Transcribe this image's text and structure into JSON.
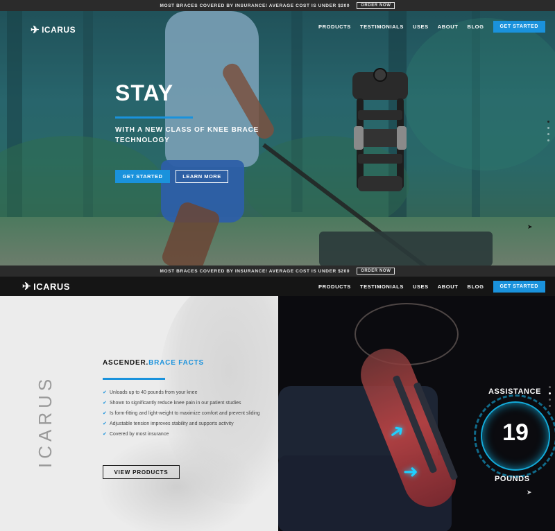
{
  "promo_top": {
    "text": "MOST BRACES COVERED BY INSURANCE! AVERAGE COST IS UNDER $200",
    "order_label": "ORDER NOW"
  },
  "hero": {
    "logo": "ICARUS",
    "nav": [
      "PRODUCTS",
      "TESTIMONIALS",
      "USES",
      "ABOUT",
      "BLOG"
    ],
    "cta": "GET STARTED",
    "title": "STAY",
    "subtitle": "WITH A NEW CLASS OF KNEE BRACE TECHNOLOGY",
    "primary_button": "GET STARTED",
    "secondary_button": "LEARN MORE"
  },
  "promo_second": {
    "text": "MOST BRACES COVERED BY INSURANCE! AVERAGE COST IS UNDER $200",
    "order_label": "ORDER NOW"
  },
  "header2": {
    "logo": "ICARUS",
    "nav": [
      "PRODUCTS",
      "TESTIMONIALS",
      "USES",
      "ABOUT",
      "BLOG"
    ],
    "cta": "GET STARTED"
  },
  "features": {
    "vertical_brand": "ICARUS",
    "title_main": "ASCENDER.",
    "title_accent": "BRACE FACTS",
    "items": [
      "Unloads up to 40 pounds from your knee",
      "Shown to significantly reduce knee pain in our patient studies",
      "Is form-fitting and light-weight to maximize comfort and prevent sliding",
      "Adjustable tension improves stability and supports activity",
      "Covered by most insurance"
    ],
    "button": "VIEW PRODUCTS"
  },
  "gauge": {
    "top_label": "ASSISTANCE",
    "value": "19",
    "unit_label": "POUNDS"
  },
  "colors": {
    "accent": "#1a92dc",
    "dark_bar": "#2b2b2b",
    "header": "#151515",
    "glow": "#1fd0ff"
  },
  "icons": [
    "bird-logo-icon",
    "check-icon",
    "cursor-icon"
  ]
}
